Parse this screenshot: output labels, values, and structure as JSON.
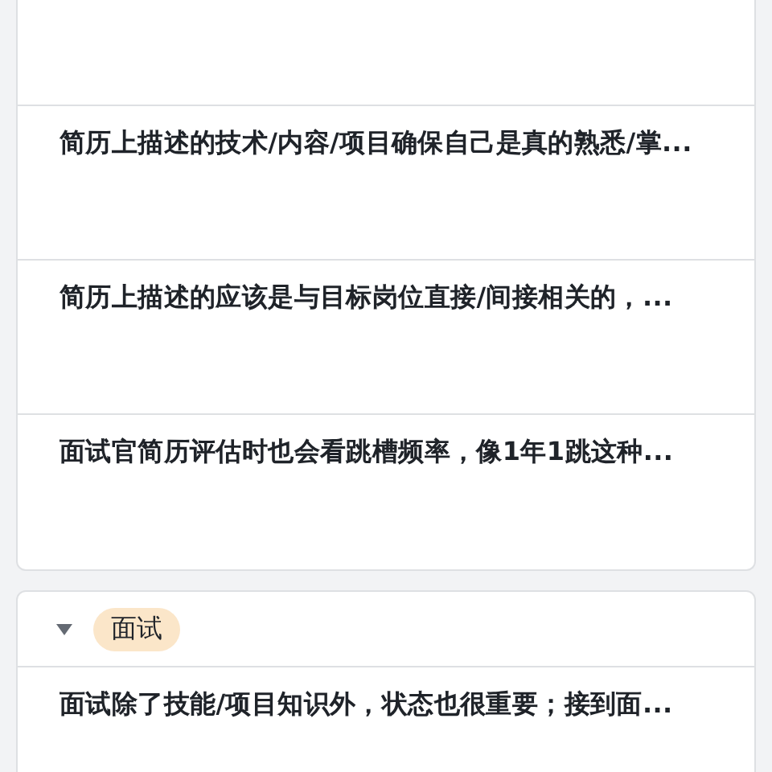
{
  "sections": [
    {
      "items": [
        "简历上描述的技术/内容/项目确保自己是真的熟悉/掌...",
        "简历上描述的应该是与目标岗位直接/间接相关的，...",
        "面试官简历评估时也会看跳槽频率，像1年1跳这种..."
      ]
    },
    {
      "tag": "面试",
      "expanded": true,
      "items": [
        "面试除了技能/项目知识外，状态也很重要；接到面..."
      ]
    }
  ]
}
